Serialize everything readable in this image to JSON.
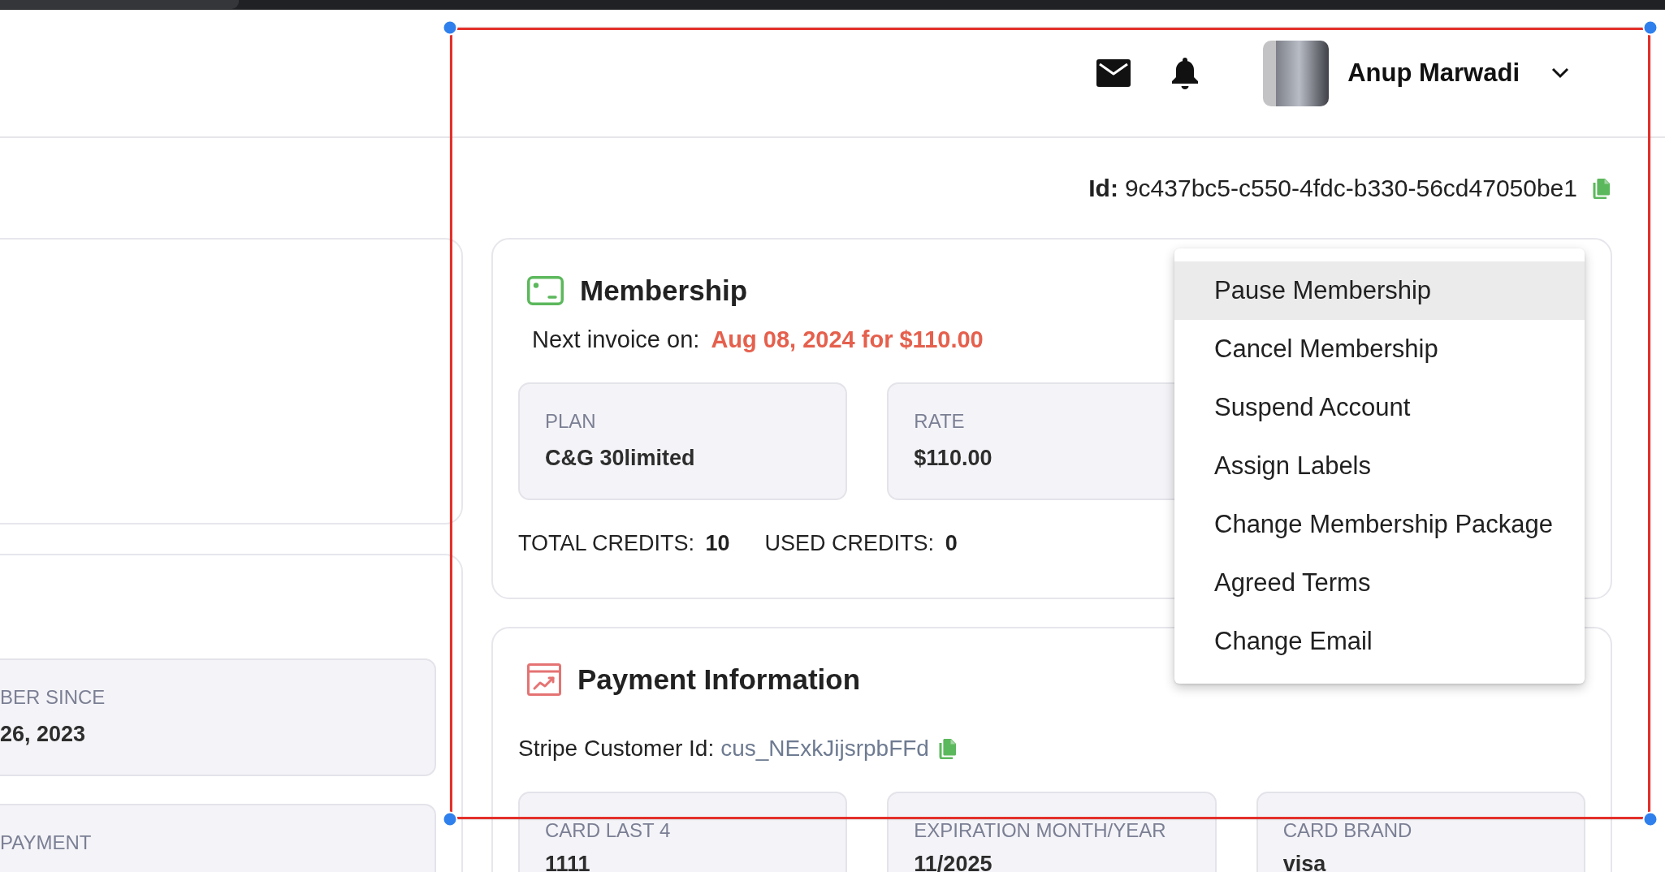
{
  "header": {
    "user_name": "Anup Marwadi"
  },
  "left_panel": {
    "fields": [
      {
        "label": "BER SINCE",
        "value": "26, 2023"
      },
      {
        "label": "PAYMENT"
      }
    ]
  },
  "customer_id": {
    "label": "Id:",
    "value": "9c437bc5-c550-4fdc-b330-56cd47050be1"
  },
  "membership": {
    "title": "Membership",
    "next_invoice": {
      "label": "Next invoice on:",
      "value": "Aug 08, 2024 for $110.00"
    },
    "fields": [
      {
        "label": "PLAN",
        "value": "C&G 30limited"
      },
      {
        "label": "RATE",
        "value": "$110.00"
      }
    ],
    "credits": [
      {
        "label": "TOTAL CREDITS:",
        "value": "10"
      },
      {
        "label": "USED CREDITS:",
        "value": "0"
      }
    ]
  },
  "payment": {
    "title": "Payment Information",
    "stripe_customer": {
      "label": "Stripe Customer Id:",
      "value": "cus_NExkJijsrpbFFd"
    },
    "fields": [
      {
        "label": "CARD LAST 4",
        "value": "1111"
      },
      {
        "label": "EXPIRATION MONTH/YEAR",
        "value": "11/2025"
      },
      {
        "label": "CARD BRAND",
        "value": "visa"
      }
    ]
  },
  "actions_menu": {
    "items": [
      {
        "label": "Pause Membership",
        "selected": true
      },
      {
        "label": "Cancel Membership",
        "selected": false
      },
      {
        "label": "Suspend Account",
        "selected": false
      },
      {
        "label": "Assign Labels",
        "selected": false
      },
      {
        "label": "Change Membership Package",
        "selected": false
      },
      {
        "label": "Agreed Terms",
        "selected": false
      },
      {
        "label": "Change Email",
        "selected": false
      }
    ]
  }
}
